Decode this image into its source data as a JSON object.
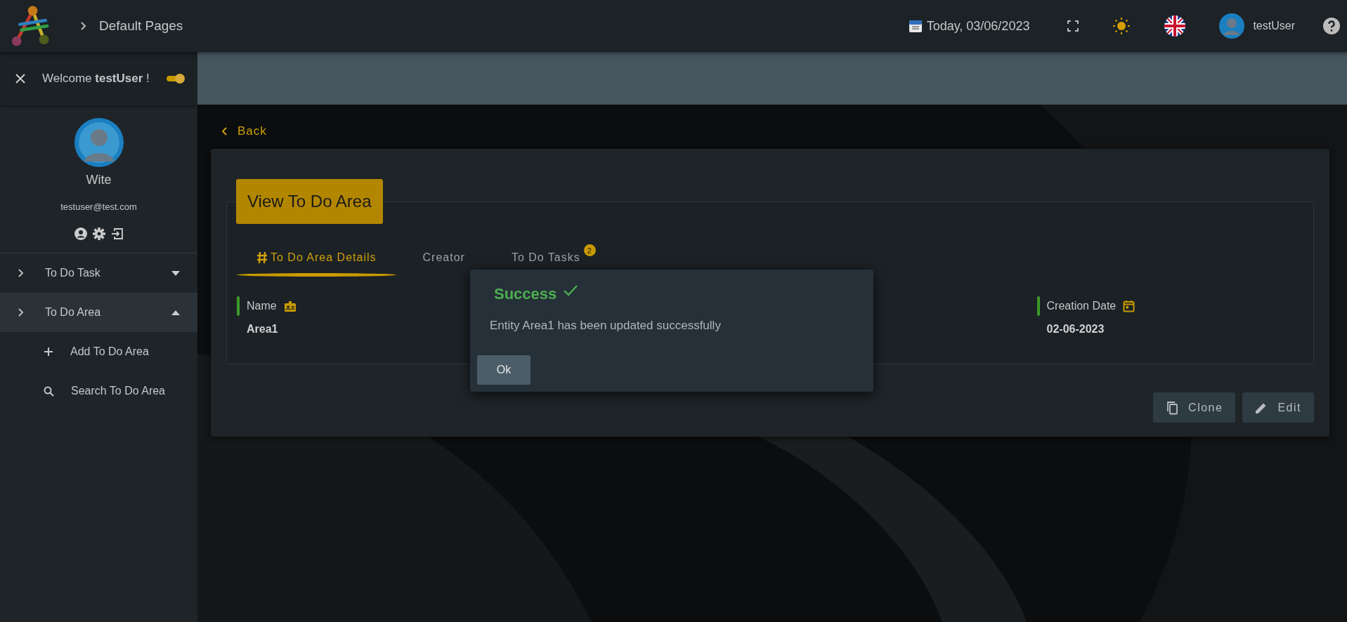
{
  "header": {
    "breadcrumb": "Default Pages",
    "date": "Today, 03/06/2023",
    "user": "testUser"
  },
  "sidebar": {
    "welcome": "Welcome **testUser** !",
    "toggle": {
      "on": true
    },
    "profile": {
      "name": "Wite",
      "email": "testuser@test.com"
    },
    "menu": [
      {
        "label": "To Do Task",
        "expanded": false,
        "selected": false
      },
      {
        "label": "To Do Area",
        "expanded": true,
        "selected": true,
        "children": [
          {
            "label": "Add To Do Area",
            "kind": "add"
          },
          {
            "label": "Search To Do Area",
            "kind": "search"
          }
        ]
      }
    ]
  },
  "main": {
    "back": "Back",
    "title": "View To Do Area",
    "tabs": [
      {
        "label": "To Do Area Details",
        "selected": true,
        "kind": "hash"
      },
      {
        "label": "Creator",
        "selected": false,
        "kind": "plain"
      },
      {
        "label": "To Do Tasks",
        "selected": false,
        "kind": "plain",
        "badge": "2"
      }
    ],
    "fields": [
      {
        "label": "Name",
        "value": "Area1",
        "kind": "id"
      },
      {
        "label": "Creation Date",
        "value": "02-06-2023",
        "kind": "date"
      }
    ],
    "buttons": [
      {
        "label": "Clone",
        "kind": "clone"
      },
      {
        "label": "Edit",
        "kind": "edit"
      }
    ]
  },
  "dialog": {
    "title": "Success",
    "message": "Entity Area1 has been updated successfully",
    "button": "Ok"
  }
}
